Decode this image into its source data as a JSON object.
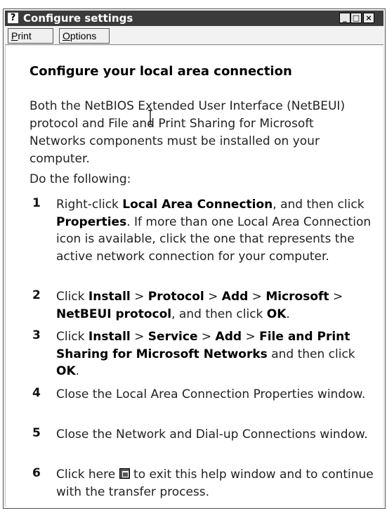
{
  "window": {
    "title": "Configure settings",
    "title_icon": "?",
    "controls": [
      "_",
      "□",
      "×"
    ]
  },
  "menu": {
    "print_label_u": "P",
    "print_label_rest": "rint",
    "options_label_u": "O",
    "options_label_rest": "ptions"
  },
  "content": {
    "heading": "Configure your local area connection",
    "intro": "Both the NetBIOS Extended User Interface (NetBEUI) protocol and File and Print Sharing for Microsoft Networks components must be installed on your computer.",
    "do_following": "Do the following:",
    "steps": [
      {
        "num": "1",
        "parts": [
          {
            "t": "Right-click ",
            "b": false
          },
          {
            "t": "Local Area Connection",
            "b": true
          },
          {
            "t": ", and then click ",
            "b": false
          },
          {
            "t": "Properties",
            "b": true
          },
          {
            "t": ".  If more than one Local Area Connection icon is available, click the one that represents the active network connection for your computer.",
            "b": false
          }
        ]
      },
      {
        "num": "2",
        "parts": [
          {
            "t": "Click ",
            "b": false
          },
          {
            "t": "Install",
            "b": true
          },
          {
            "t": " > ",
            "b": false
          },
          {
            "t": "Protocol",
            "b": true
          },
          {
            "t": " > ",
            "b": false
          },
          {
            "t": "Add",
            "b": true
          },
          {
            "t": " > ",
            "b": false
          },
          {
            "t": "Microsoft",
            "b": true
          },
          {
            "t": " > ",
            "b": false
          },
          {
            "t": "NetBEUI protocol",
            "b": true
          },
          {
            "t": ", and then click ",
            "b": false
          },
          {
            "t": "OK",
            "b": true
          },
          {
            "t": ".",
            "b": false
          }
        ]
      },
      {
        "num": "3",
        "parts": [
          {
            "t": "Click ",
            "b": false
          },
          {
            "t": "Install",
            "b": true
          },
          {
            "t": " > ",
            "b": false
          },
          {
            "t": "Service",
            "b": true
          },
          {
            "t": " > ",
            "b": false
          },
          {
            "t": "Add",
            "b": true
          },
          {
            "t": " > ",
            "b": false
          },
          {
            "t": "File and Print Sharing for Microsoft Networks",
            "b": true
          },
          {
            "t": " and then click ",
            "b": false
          },
          {
            "t": "OK",
            "b": true
          },
          {
            "t": ".",
            "b": false
          }
        ]
      },
      {
        "num": "4",
        "parts": [
          {
            "t": "Close the Local Area Connection Properties window.",
            "b": false
          }
        ]
      },
      {
        "num": "5",
        "parts": [
          {
            "t": "Close the Network and Dial-up Connections window.",
            "b": false
          }
        ]
      },
      {
        "num": "6",
        "parts": [
          {
            "t": "Click here ",
            "b": false
          },
          {
            "icon": "close-window-icon"
          },
          {
            "t": " to exit this help window and to continue with the transfer process.",
            "b": false
          }
        ]
      }
    ]
  }
}
